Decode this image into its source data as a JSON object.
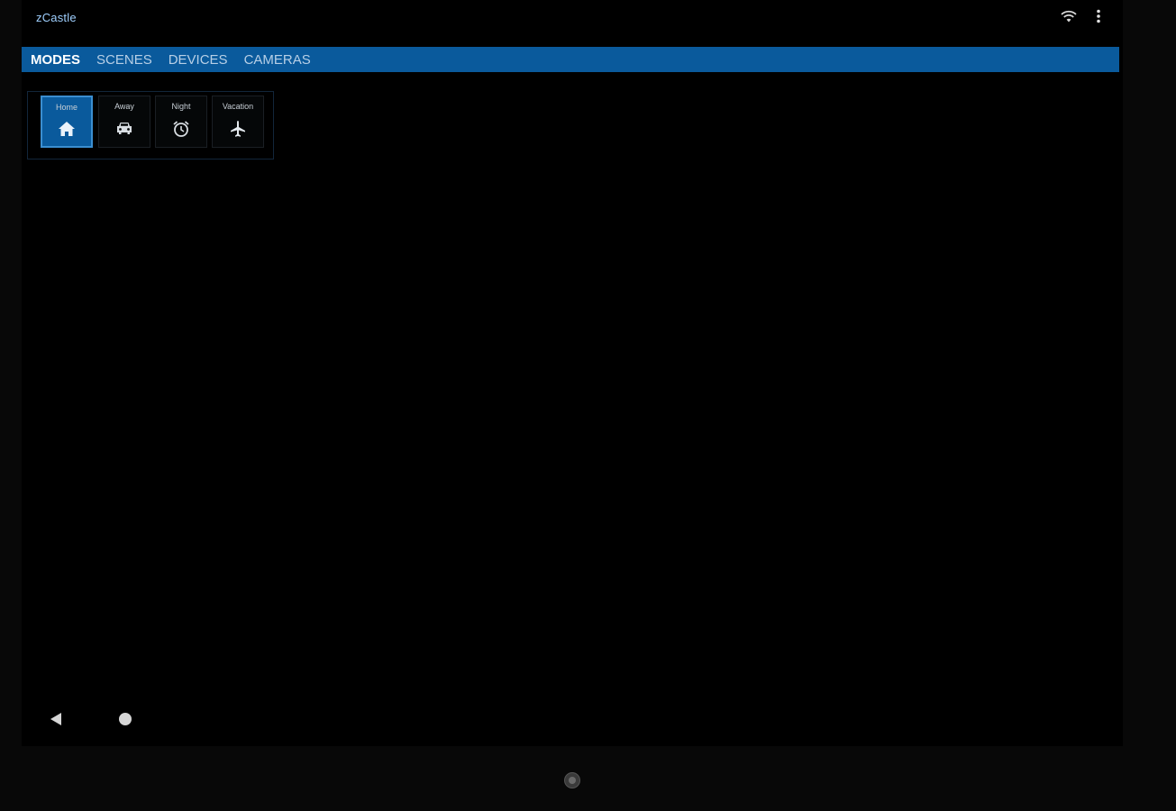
{
  "app": {
    "title": "zCastle"
  },
  "status_bar": {
    "wifi_icon": "wifi-icon",
    "menu_icon": "more-vert-icon"
  },
  "tabs": [
    {
      "label": "MODES",
      "active": true
    },
    {
      "label": "SCENES",
      "active": false
    },
    {
      "label": "DEVICES",
      "active": false
    },
    {
      "label": "CAMERAS",
      "active": false
    }
  ],
  "modes": [
    {
      "label": "Home",
      "icon": "home-icon",
      "active": true
    },
    {
      "label": "Away",
      "icon": "car-icon",
      "active": false
    },
    {
      "label": "Night",
      "icon": "alarm-clock-icon",
      "active": false
    },
    {
      "label": "Vacation",
      "icon": "airplane-icon",
      "active": false
    }
  ],
  "navigation": {
    "back_icon": "back-triangle-icon",
    "home_icon": "home-circle-icon"
  },
  "colors": {
    "tab_bar": "#0a5a9c",
    "active_mode": "#0a5a9c",
    "title_text": "#9fd0ff",
    "background": "#000000"
  }
}
